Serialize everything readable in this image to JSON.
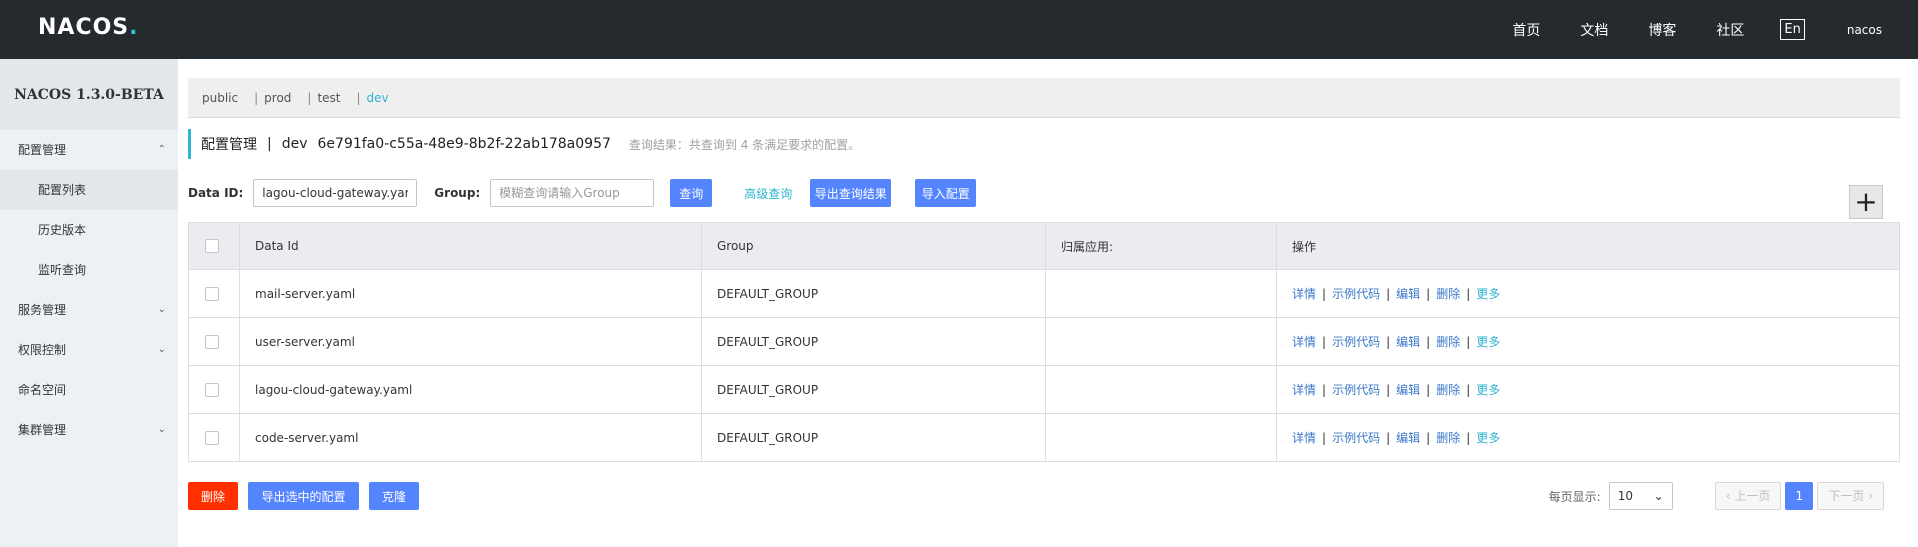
{
  "header": {
    "logo": "NACOS",
    "logo_dot": ".",
    "nav": [
      "首页",
      "文档",
      "博客",
      "社区"
    ],
    "lang": "En",
    "user": "nacos"
  },
  "sidebar": {
    "version": "NACOS 1.3.0-BETA",
    "groups": [
      {
        "label": "配置管理",
        "expanded": true,
        "children": [
          "配置列表",
          "历史版本",
          "监听查询"
        ]
      },
      {
        "label": "服务管理",
        "expanded": false
      },
      {
        "label": "权限控制",
        "expanded": false
      },
      {
        "label": "命名空间"
      },
      {
        "label": "集群管理",
        "expanded": false
      }
    ],
    "active_child": "配置列表"
  },
  "namespaces": {
    "items": [
      "public",
      "prod",
      "test",
      "dev"
    ],
    "active": "dev",
    "separator": "|"
  },
  "title": {
    "main": "配置管理",
    "pipe": "|",
    "namespace": "dev",
    "namespace_id": "6e791fa0-c55a-48e9-8b2f-22ab178a0957",
    "result_text": "查询结果：共查询到 4 条满足要求的配置。"
  },
  "search": {
    "dataid_label": "Data ID:",
    "dataid_value": "lagou-cloud-gateway.yaml",
    "group_label": "Group:",
    "group_placeholder": "模糊查询请输入Group",
    "query_btn": "查询",
    "advanced_link": "高级查询",
    "export_btn": "导出查询结果",
    "import_btn": "导入配置",
    "add_icon": "plus-icon"
  },
  "table": {
    "columns": [
      "Data Id",
      "Group",
      "归属应用:",
      "操作"
    ],
    "rows": [
      {
        "data_id": "mail-server.yaml",
        "group": "DEFAULT_GROUP",
        "app": ""
      },
      {
        "data_id": "user-server.yaml",
        "group": "DEFAULT_GROUP",
        "app": ""
      },
      {
        "data_id": "lagou-cloud-gateway.yaml",
        "group": "DEFAULT_GROUP",
        "app": ""
      },
      {
        "data_id": "code-server.yaml",
        "group": "DEFAULT_GROUP",
        "app": ""
      }
    ],
    "ops": {
      "detail": "详情",
      "sample": "示例代码",
      "edit": "编辑",
      "delete": "删除",
      "more": "更多",
      "bar": "|"
    }
  },
  "bottom": {
    "delete_btn": "删除",
    "export_selected_btn": "导出选中的配置",
    "clone_btn": "克隆"
  },
  "pager": {
    "page_size_label": "每页显示:",
    "page_size": "10",
    "prev": "上一页",
    "current": "1",
    "next": "下一页"
  },
  "colors": {
    "topbar": "#252a2f",
    "accent": "#2fb5d2",
    "primary": "#5584ff",
    "danger": "#ff3000"
  }
}
